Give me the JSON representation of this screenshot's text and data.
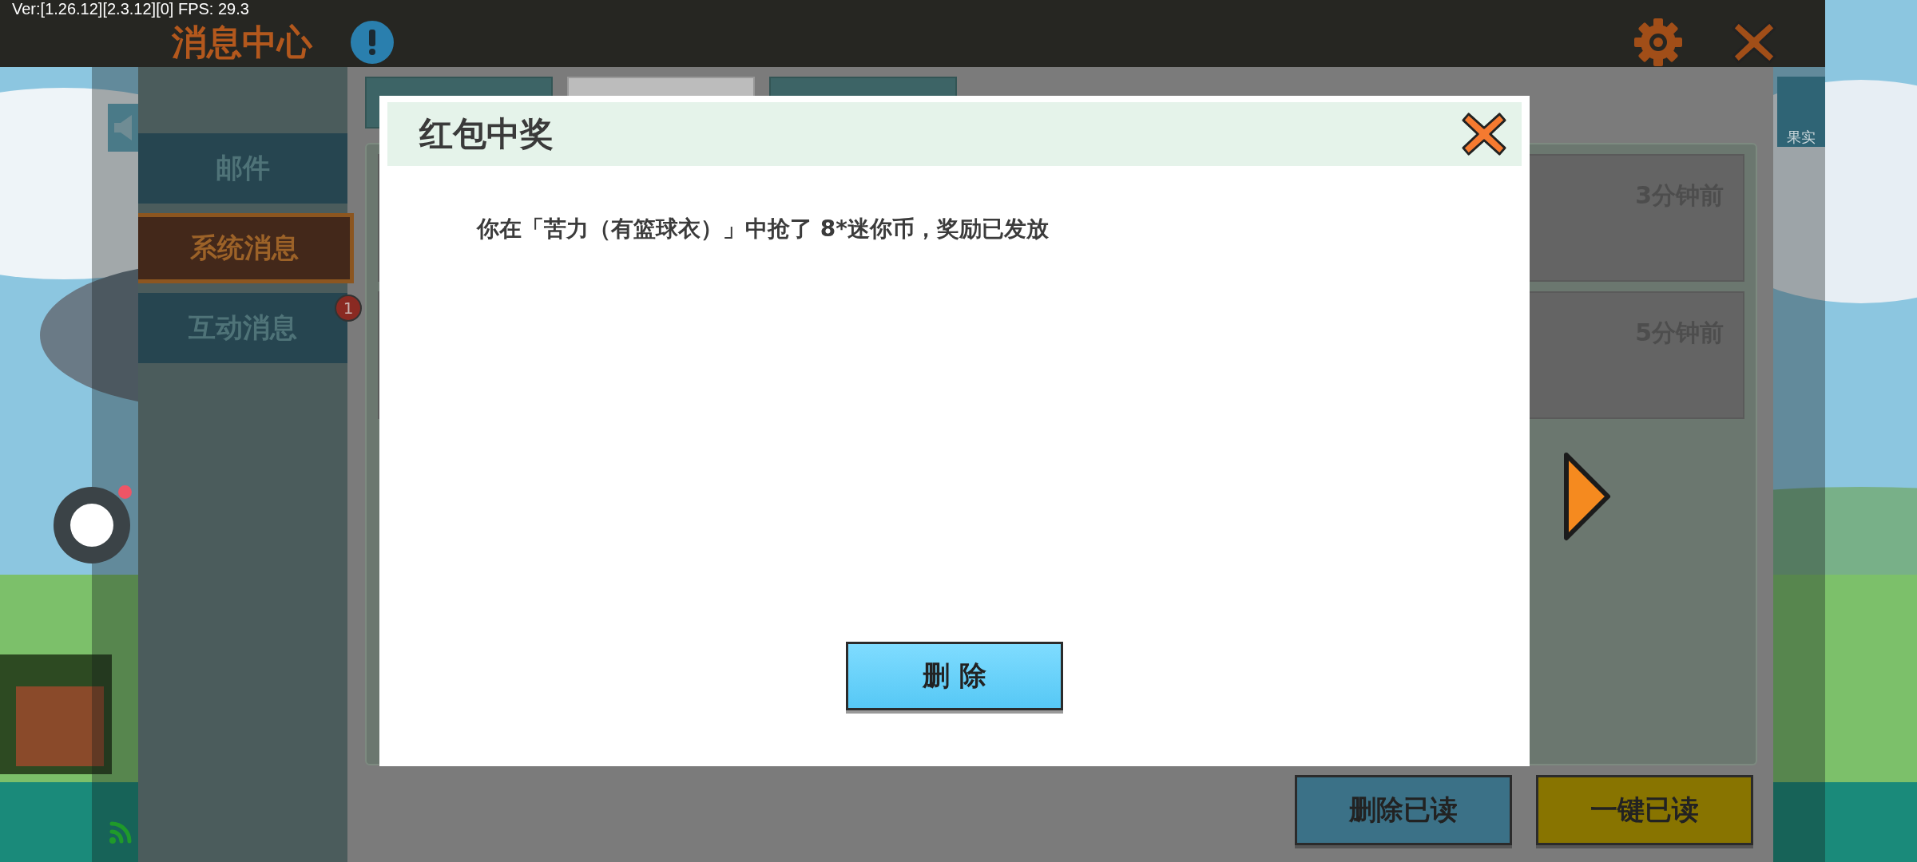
{
  "status_text": "Ver:[1.26.12][2.3.12][0] FPS: 29.3",
  "header": {
    "title": "消息中心"
  },
  "sidebar": {
    "items": [
      {
        "label": "邮件",
        "selected": false
      },
      {
        "label": "系统消息",
        "selected": true
      },
      {
        "label": "互动消息",
        "selected": false,
        "badge": "1"
      }
    ]
  },
  "tabs": [
    {
      "selected": false
    },
    {
      "selected": true
    },
    {
      "selected": false
    }
  ],
  "side_icon": {
    "label": "果实"
  },
  "messages": [
    {
      "time": "3分钟前"
    },
    {
      "time": "5分钟前"
    }
  ],
  "actions": [
    {
      "label": "删除已读",
      "kind": "blue"
    },
    {
      "label": "一键已读",
      "kind": "yellow"
    }
  ],
  "dialog": {
    "title": "红包中奖",
    "body": "你在「苦力（有篮球衣）」中抢了 8*迷你币，奖励已发放",
    "button": "删 除"
  }
}
